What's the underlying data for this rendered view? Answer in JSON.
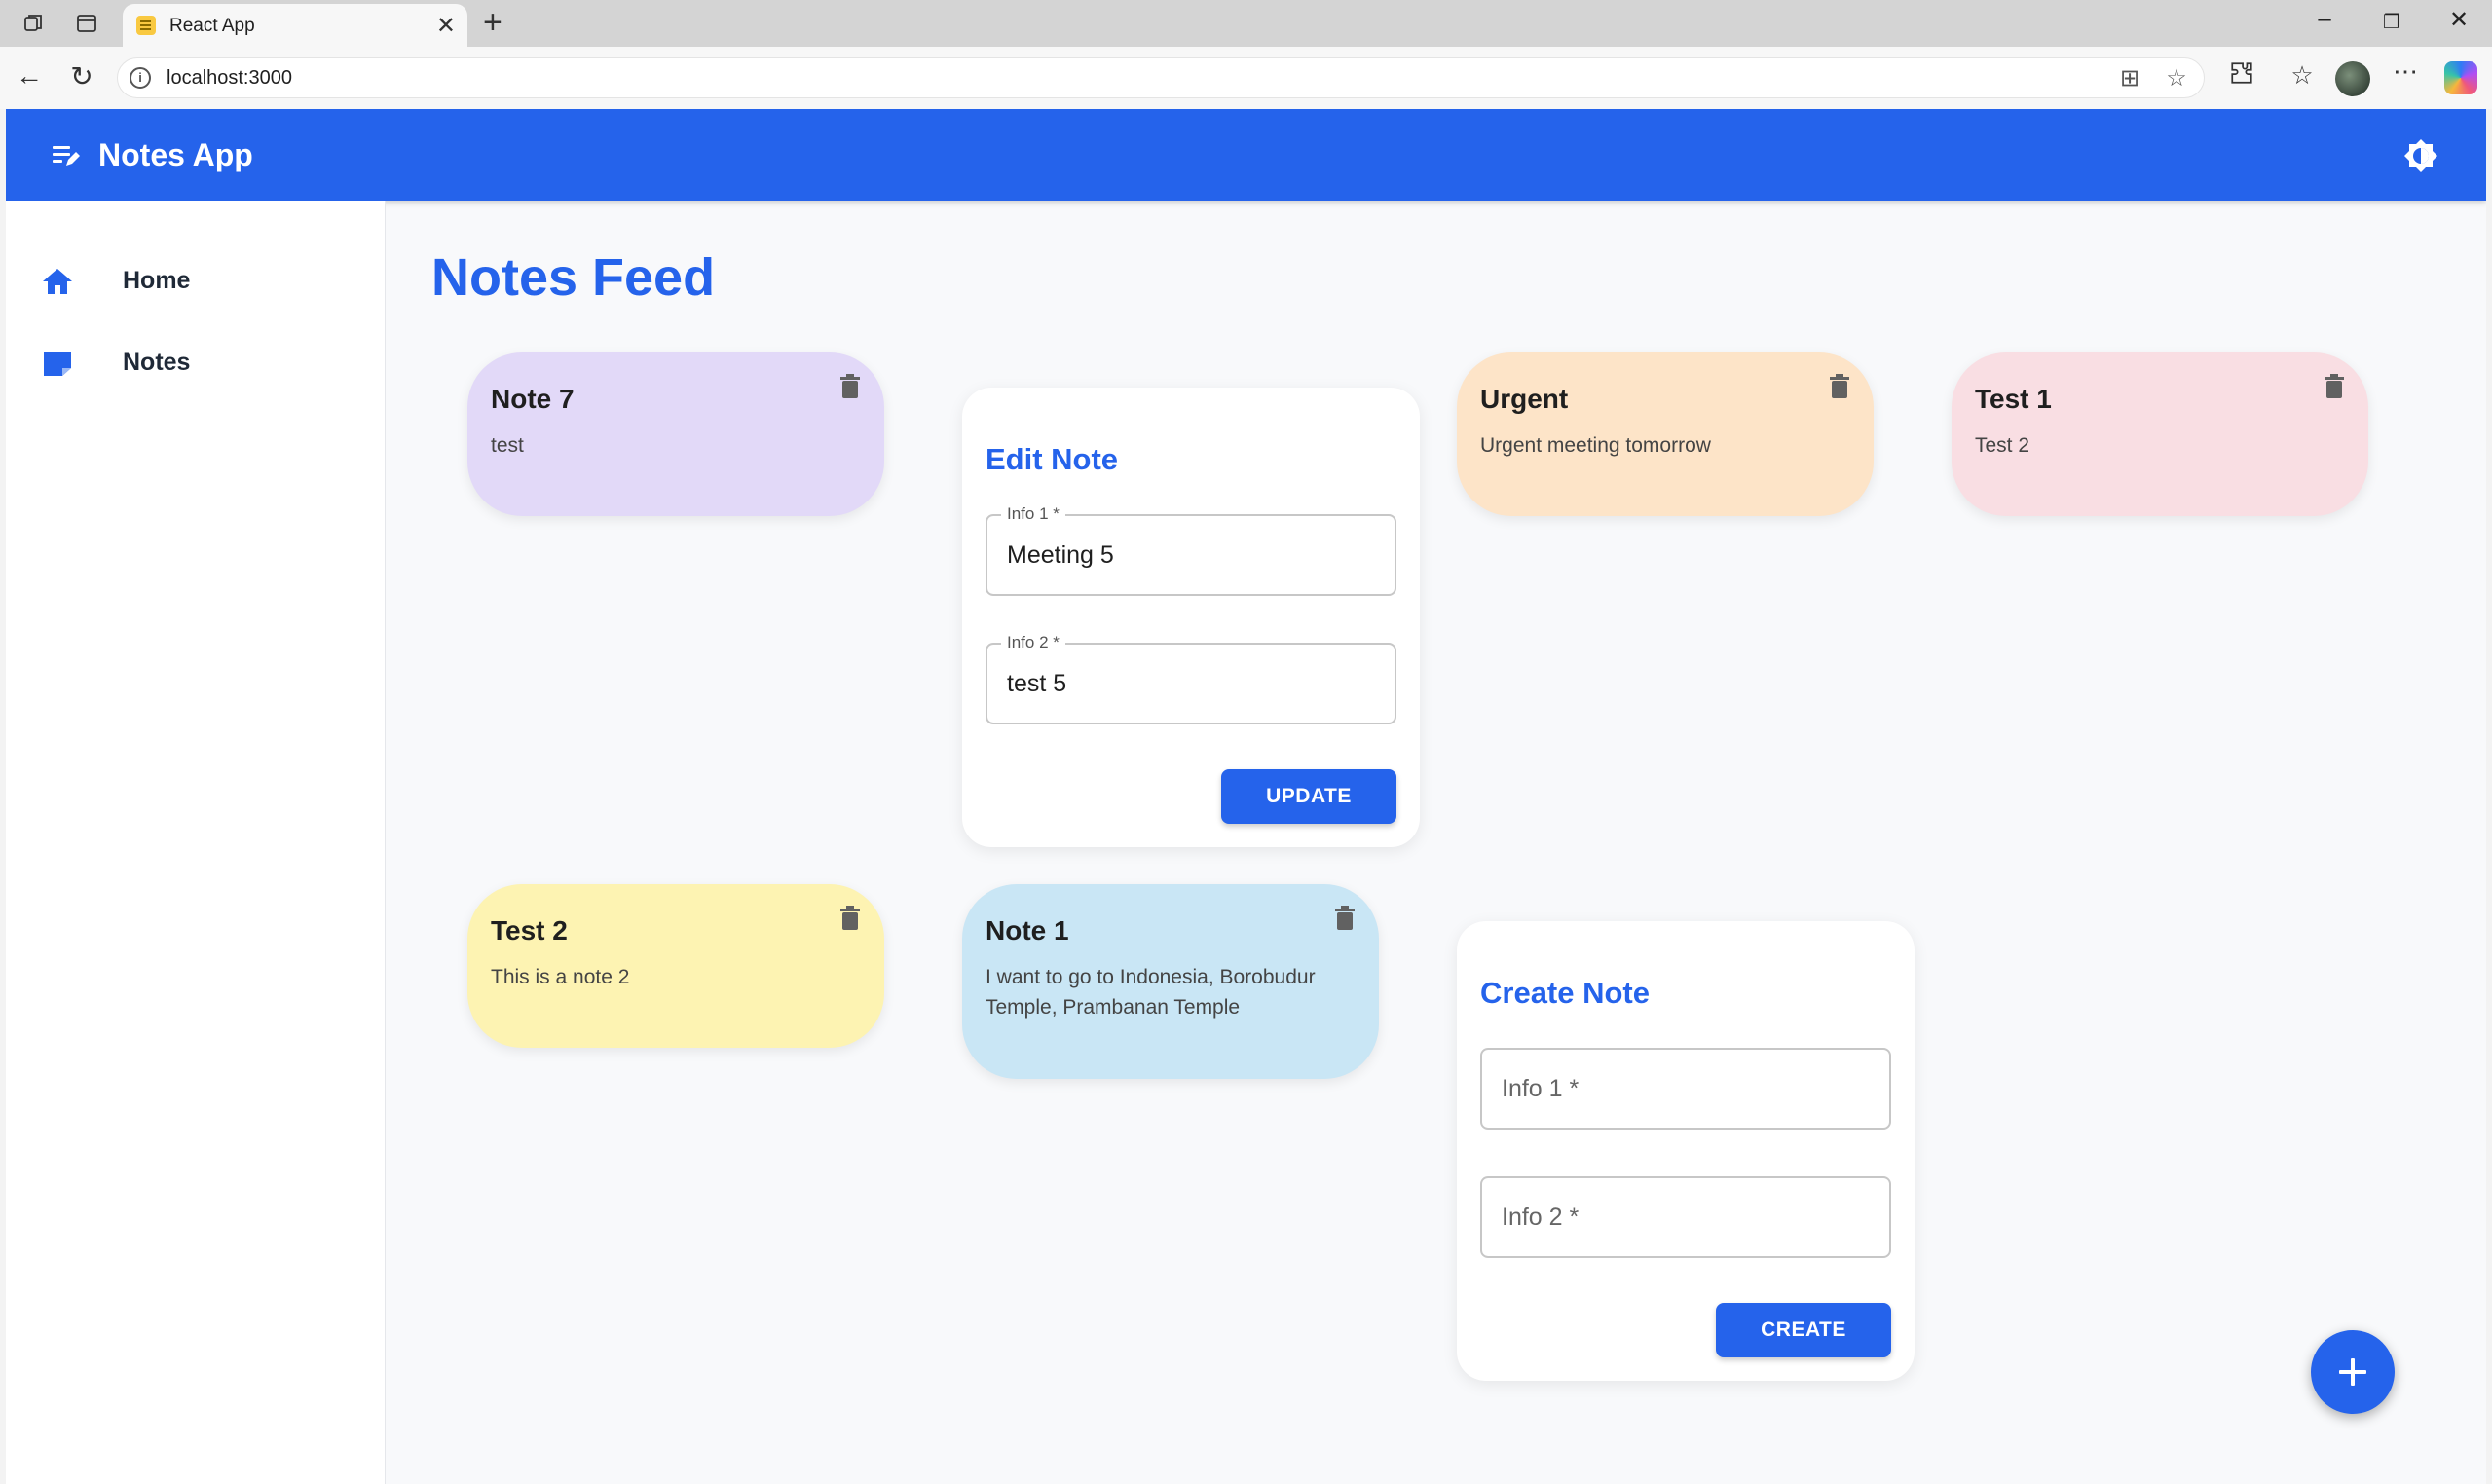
{
  "browser": {
    "tab_title": "React App",
    "url": "localhost:3000"
  },
  "app": {
    "title": "Notes App"
  },
  "sidebar": {
    "items": [
      {
        "label": "Home",
        "icon": "home-icon"
      },
      {
        "label": "Notes",
        "icon": "notes-icon"
      }
    ]
  },
  "feed": {
    "title": "Notes Feed",
    "notes": [
      {
        "title": "Note 7",
        "body": "test",
        "color": "#e2d9f8"
      },
      {
        "title": "Urgent",
        "body": "Urgent meeting tomorrow",
        "color": "#fde4c8"
      },
      {
        "title": "Test 1",
        "body": "Test 2",
        "color": "#f9dee3"
      },
      {
        "title": "Test 2",
        "body": "This is a note 2",
        "color": "#fdf3b2"
      },
      {
        "title": "Note 1",
        "body": "I want to go to Indonesia, Borobudur Temple, Prambanan Temple",
        "color": "#c9e6f5"
      }
    ]
  },
  "edit_form": {
    "title": "Edit Note",
    "field1_label": "Info 1 *",
    "field1_value": "Meeting 5",
    "field2_label": "Info 2 *",
    "field2_value": "test 5",
    "button": "UPDATE"
  },
  "create_form": {
    "title": "Create Note",
    "field1_placeholder": "Info 1 *",
    "field2_placeholder": "Info 2 *",
    "button": "CREATE"
  },
  "colors": {
    "primary": "#2563eb",
    "background": "#f8f9fb"
  }
}
